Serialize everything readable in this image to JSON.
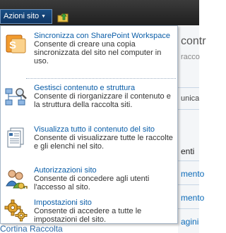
{
  "ribbon": {
    "site_actions_label": "Azioni sito",
    "dropdown_arrow": "▼"
  },
  "menu": {
    "items": [
      {
        "title": "Sincronizza con SharePoint Workspace",
        "description": "Consente di creare una copia sincronizzata del sito nel computer in uso.",
        "icon": "sharepoint-workspace-icon"
      },
      {
        "title": "Gestisci contenuto e struttura",
        "description": "Consente di riorganizzare il contenuto e la struttura della raccolta siti.",
        "icon": "manage-structure-icon"
      },
      {
        "title": "Visualizza tutto il contenuto del sito",
        "description": "Consente di visualizzare tutte le raccolte e gli elenchi nel sito.",
        "icon": "view-content-icon"
      },
      {
        "title": "Autorizzazioni sito",
        "description": "Consente di concedere agli utenti l'accesso al sito.",
        "icon": "permissions-icon"
      },
      {
        "title": "Impostazioni sito",
        "description": "Consente di accedere a tutte le impostazioni del sito.",
        "icon": "settings-gear-icon"
      }
    ]
  },
  "background": {
    "title_fragment": "contr",
    "subtitle_fragment": "racco",
    "comm_fragment": "unica",
    "column_fragment": "enti",
    "links": [
      "mento",
      "mento",
      "agini"
    ],
    "bottom_link_fragment": "Cortina Raccolta"
  },
  "colors": {
    "accent": "#0b5ea8",
    "site_actions_bg": "#1a4f85",
    "topbar_bg": "#2a2a2a",
    "menu_border": "#a7b7c9"
  }
}
